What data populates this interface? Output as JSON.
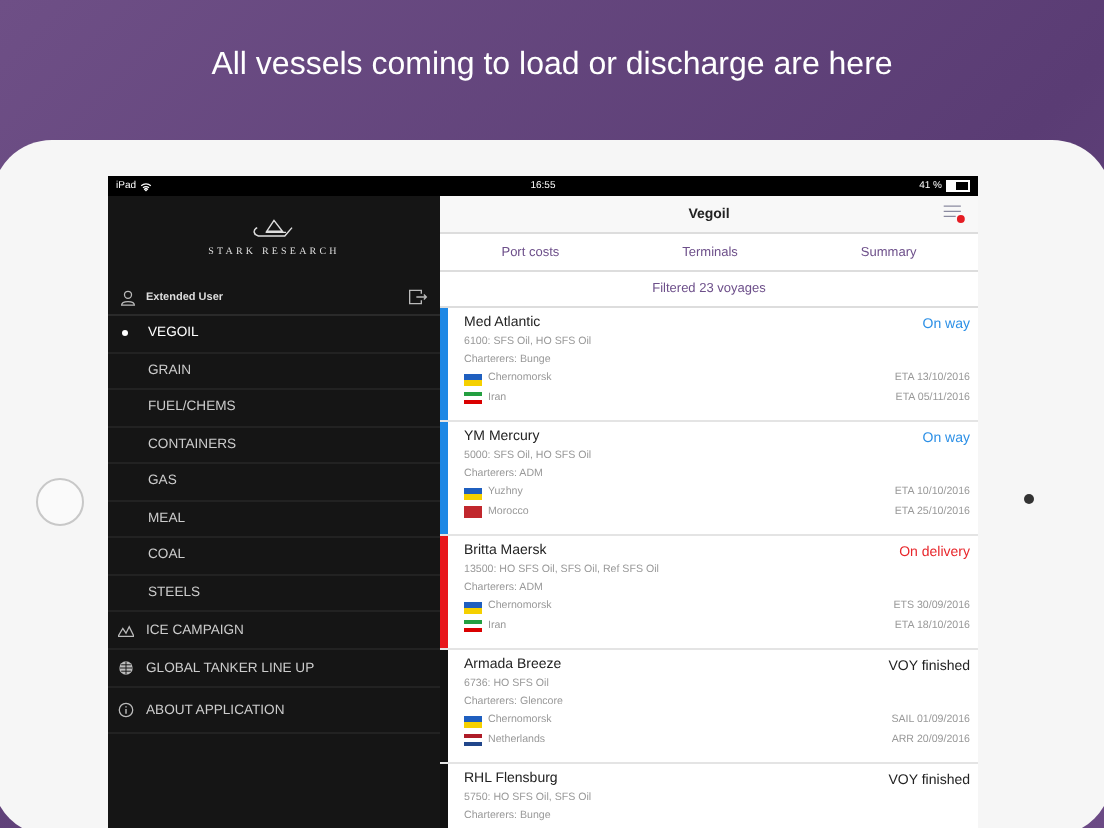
{
  "headline": "All vessels coming to load or discharge are here",
  "status_bar": {
    "device": "iPad",
    "time": "16:55",
    "battery": "41 %"
  },
  "sidebar": {
    "logo_text": "STARK RESEARCH",
    "user": "Extended User",
    "categories": [
      {
        "label": "VEGOIL",
        "selected": true
      },
      {
        "label": "GRAIN",
        "selected": false
      },
      {
        "label": "FUEL/CHEMS",
        "selected": false
      },
      {
        "label": "CONTAINERS",
        "selected": false
      },
      {
        "label": "GAS",
        "selected": false
      },
      {
        "label": "MEAL",
        "selected": false
      },
      {
        "label": "COAL",
        "selected": false
      },
      {
        "label": "STEELS",
        "selected": false
      }
    ],
    "sections": [
      {
        "kind": "ice",
        "label": "ICE CAMPAIGN"
      },
      {
        "kind": "globe",
        "label": "GLOBAL TANKER LINE UP"
      },
      {
        "kind": "info",
        "label": "ABOUT APPLICATION"
      }
    ]
  },
  "header": {
    "title": "Vegoil"
  },
  "tabs": [
    {
      "label": "Port costs"
    },
    {
      "label": "Terminals"
    },
    {
      "label": "Summary"
    }
  ],
  "filter_summary": "Filtered 23 voyages",
  "voyages": [
    {
      "color": "#1e88e5",
      "name": "Med Atlantic",
      "status": {
        "text": "On way",
        "color": "#2b8fe6"
      },
      "cargo": "6100: SFS Oil, HO SFS Oil",
      "charterers": "Charterers: Bunge",
      "ports": [
        {
          "kind": "ukraine",
          "name": "Chernomorsk",
          "date": "ETA 13/10/2016"
        },
        {
          "kind": "iran",
          "name": "Iran",
          "date": "ETA 05/11/2016"
        }
      ]
    },
    {
      "color": "#1e88e5",
      "name": "YM Mercury",
      "status": {
        "text": "On way",
        "color": "#2b8fe6"
      },
      "cargo": "5000: SFS Oil, HO SFS Oil",
      "charterers": "Charterers: ADM",
      "ports": [
        {
          "kind": "ukraine",
          "name": "Yuzhny",
          "date": "ETA 10/10/2016"
        },
        {
          "kind": "morocco",
          "name": "Morocco",
          "date": "ETA 25/10/2016"
        }
      ]
    },
    {
      "color": "#e8161b",
      "name": "Britta Maersk",
      "status": {
        "text": "On delivery",
        "color": "#e8262b"
      },
      "cargo": "13500: HO SFS Oil, SFS Oil, Ref SFS Oil",
      "charterers": "Charterers: ADM",
      "ports": [
        {
          "kind": "ukraine",
          "name": "Chernomorsk",
          "date": "ETS 30/09/2016"
        },
        {
          "kind": "iran",
          "name": "Iran",
          "date": "ETA 18/10/2016"
        }
      ]
    },
    {
      "color": "#111111",
      "name": "Armada Breeze",
      "status": {
        "text": "VOY finished",
        "color": "#222222"
      },
      "cargo": "6736: HO SFS Oil",
      "charterers": "Charterers: Glencore",
      "ports": [
        {
          "kind": "ukraine",
          "name": "Chernomorsk",
          "date": "SAIL 01/09/2016"
        },
        {
          "kind": "netherlands",
          "name": "Netherlands",
          "date": "ARR 20/09/2016"
        }
      ]
    },
    {
      "color": "#111111",
      "name": "RHL Flensburg",
      "status": {
        "text": "VOY finished",
        "color": "#222222"
      },
      "cargo": "5750: HO SFS Oil, SFS Oil",
      "charterers": "Charterers: Bunge"
    }
  ]
}
